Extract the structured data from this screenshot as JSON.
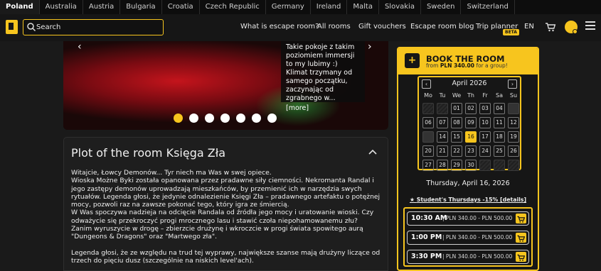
{
  "countries": [
    "Poland",
    "Australia",
    "Austria",
    "Bulgaria",
    "Croatia",
    "Czech Republic",
    "Germany",
    "Ireland",
    "Malta",
    "Slovakia",
    "Sweden",
    "Switzerland"
  ],
  "header": {
    "search_placeholder": "Search",
    "nav": [
      "What is escape room?",
      "All rooms",
      "Gift vouchers",
      "Escape room blog",
      "Trip planner"
    ],
    "beta": "BETA",
    "language": "EN"
  },
  "gallery": {
    "quote": "Takie pokoje z takim poziomiem immersji to my lubimy :) Klimat trzymany od samego początku, zaczynając od zgrabnego w...",
    "more": "[more]",
    "slide_count": 7,
    "active_slide": 1
  },
  "plot": {
    "title": "Plot of the room Księga Zła",
    "paragraphs": [
      "Witajcie, Łowcy Demonów... Tyr niech ma Was w swej opiece.",
      "Wioska Możne Byki została opanowana przez pradawne siły ciemności. Nekromanta Randal i jego zastępy demonów uprowadzają mieszkańców, by przemienić ich w narzędzia swych rytuałów. Legenda głosi, że jedynie odnalezienie Księgi Zła – pradawnego artefaktu o potężnej mocy, pozwoli raz na zawsze pokonać tego, który igra ze śmiercią.",
      "W Was spoczywa nadzieja na odcięcie Randala od źródła jego mocy i uratowanie wioski. Czy odważycie się przekroczyć progi mrocznego lasu i stawić czoła niepohamowanemu złu?",
      "Zanim wyruszycie w drogę – zbierzcie drużynę i wkroczcie w progi świata spowitego aurą \"Dungeons & Dragons\" oraz \"Martwego zła\".",
      "",
      "Legenda głosi, że ze względu na trud tej wyprawy, największe szanse mają drużyny liczące od trzech do pięciu dusz (szczególnie na niskich level'ach)."
    ]
  },
  "booking": {
    "title": "BOOK THE ROOM",
    "subtitle_prefix": "from ",
    "subtitle_price": "PLN 340.00",
    "subtitle_suffix": " for a group!",
    "month": "April 2026",
    "weekdays": [
      "Mo",
      "Tu",
      "We",
      "Th",
      "Fr",
      "Sa",
      "Su"
    ],
    "days": [
      {
        "label": "",
        "state": "unavailable"
      },
      {
        "label": "",
        "state": "unavailable"
      },
      {
        "label": "01",
        "state": "available"
      },
      {
        "label": "02",
        "state": "available"
      },
      {
        "label": "03",
        "state": "available"
      },
      {
        "label": "04",
        "state": "available"
      },
      {
        "label": "",
        "state": "other"
      },
      {
        "label": "06",
        "state": "available"
      },
      {
        "label": "07",
        "state": "available"
      },
      {
        "label": "08",
        "state": "available"
      },
      {
        "label": "09",
        "state": "available"
      },
      {
        "label": "10",
        "state": "available"
      },
      {
        "label": "11",
        "state": "available"
      },
      {
        "label": "12",
        "state": "available"
      },
      {
        "label": "",
        "state": "other"
      },
      {
        "label": "14",
        "state": "available"
      },
      {
        "label": "15",
        "state": "available"
      },
      {
        "label": "16",
        "state": "selected"
      },
      {
        "label": "17",
        "state": "available"
      },
      {
        "label": "18",
        "state": "available"
      },
      {
        "label": "19",
        "state": "available"
      },
      {
        "label": "20",
        "state": "available"
      },
      {
        "label": "21",
        "state": "available"
      },
      {
        "label": "22",
        "state": "available"
      },
      {
        "label": "23",
        "state": "available"
      },
      {
        "label": "24",
        "state": "available"
      },
      {
        "label": "25",
        "state": "available"
      },
      {
        "label": "26",
        "state": "available"
      },
      {
        "label": "27",
        "state": "available"
      },
      {
        "label": "28",
        "state": "available"
      },
      {
        "label": "29",
        "state": "available"
      },
      {
        "label": "30",
        "state": "available"
      },
      {
        "label": "",
        "state": "unavailable"
      },
      {
        "label": "",
        "state": "unavailable"
      },
      {
        "label": "",
        "state": "unavailable"
      }
    ],
    "selected_date": "Thursday, April 16, 2026",
    "promo": "Student's Thursdays -15% [details]",
    "slots": [
      {
        "time": "10:30 AM",
        "price": "| PLN 340.00 - PLN 500.00"
      },
      {
        "time": "1:00 PM",
        "price": "| PLN 340.00 - PLN 500.00"
      },
      {
        "time": "3:30 PM",
        "price": "| PLN 340.00 - PLN 500.00"
      }
    ]
  },
  "colors": {
    "accent": "#f7c51e",
    "background": "#1a1a1a"
  }
}
